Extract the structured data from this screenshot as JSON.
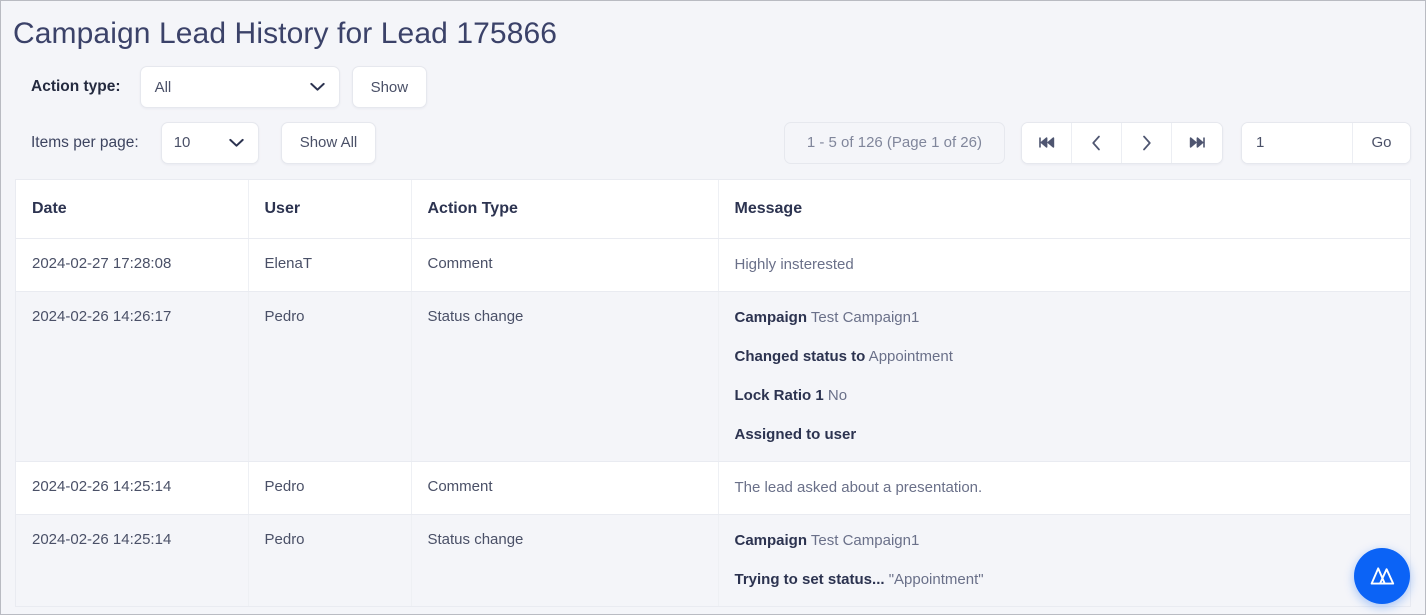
{
  "header": {
    "title": "Campaign Lead History for Lead 175866"
  },
  "filter": {
    "label": "Action type:",
    "selected": "All",
    "options": [
      "All"
    ],
    "show_button": "Show"
  },
  "pager": {
    "items_per_page_label": "Items per page:",
    "items_per_page_value": "10",
    "items_per_page_options": [
      "10"
    ],
    "show_all_button": "Show All",
    "status": "1 - 5 of 126 (Page 1 of 26)",
    "first_icon": "first-page-icon",
    "prev_icon": "previous-page-icon",
    "next_icon": "next-page-icon",
    "last_icon": "last-page-icon",
    "page_input_value": "1",
    "go_button": "Go"
  },
  "table": {
    "columns": [
      "Date",
      "User",
      "Action Type",
      "Message"
    ],
    "rows": [
      {
        "date": "2024-02-27 17:28:08",
        "user": "ElenaT",
        "action_type": "Comment",
        "message_lines": [
          {
            "label": "",
            "value": "Highly insterested"
          }
        ]
      },
      {
        "date": "2024-02-26 14:26:17",
        "user": "Pedro",
        "action_type": "Status change",
        "message_lines": [
          {
            "label": "Campaign",
            "value": "Test Campaign1"
          },
          {
            "label": "Changed status to",
            "value": "Appointment"
          },
          {
            "label": "Lock Ratio 1",
            "value": "No"
          },
          {
            "label": "Assigned to user",
            "value": ""
          }
        ]
      },
      {
        "date": "2024-02-26 14:25:14",
        "user": "Pedro",
        "action_type": "Comment",
        "message_lines": [
          {
            "label": "",
            "value": "The lead asked about a presentation."
          }
        ]
      },
      {
        "date": "2024-02-26 14:25:14",
        "user": "Pedro",
        "action_type": "Status change",
        "message_lines": [
          {
            "label": "Campaign",
            "value": "Test Campaign1"
          },
          {
            "label": "Trying to set status...",
            "value": "\"Appointment\""
          }
        ]
      }
    ]
  },
  "fab": {
    "icon": "brand-logo-icon",
    "color": "#0b63f6"
  },
  "colors": {
    "page_background": "#f4f5f9",
    "title": "#3b4269",
    "row_alt": "#f4f5f9",
    "border": "#e9ebf1"
  }
}
